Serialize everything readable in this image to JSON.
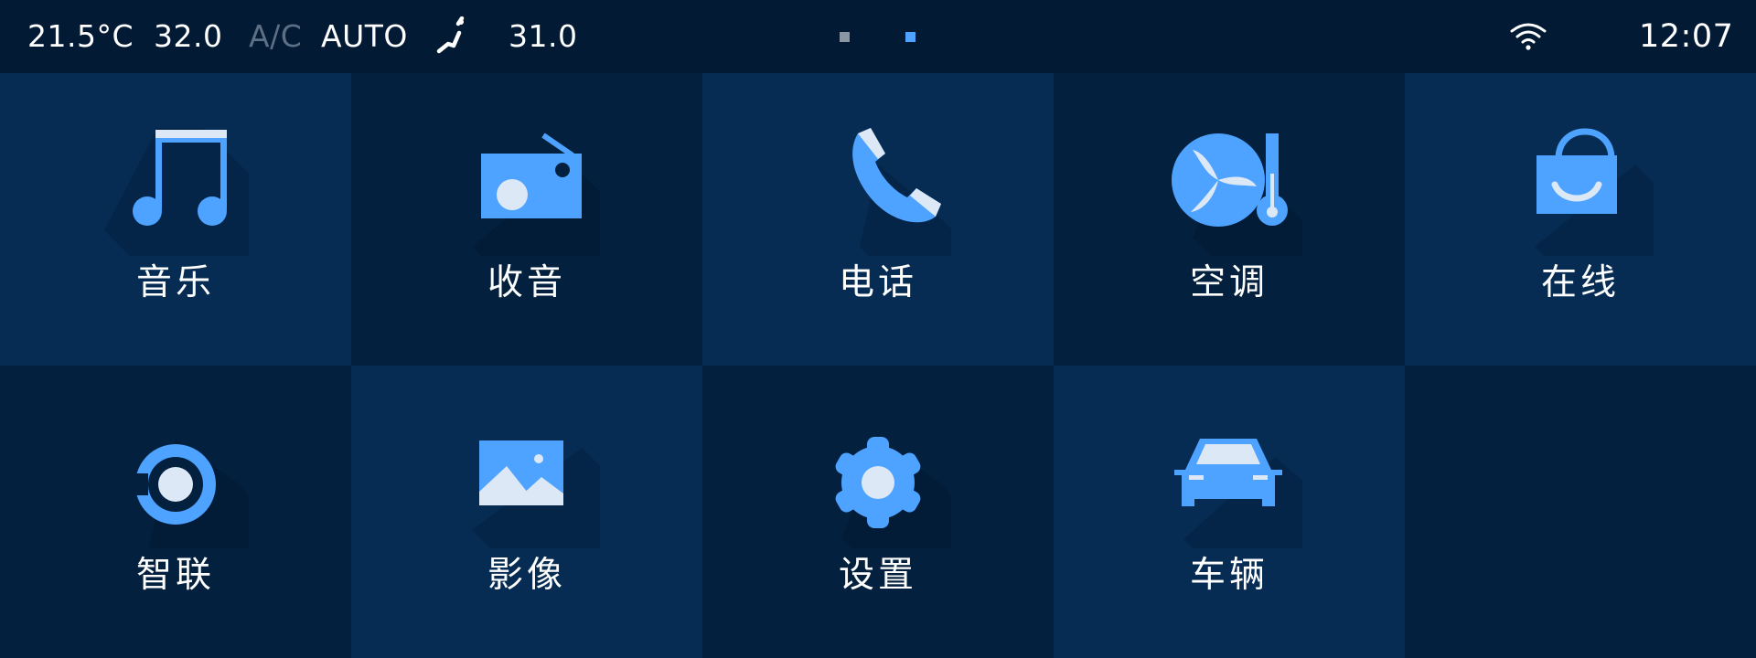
{
  "status_bar": {
    "temperature_left": "21.5°C",
    "setting_left": "32.0",
    "ac_label": "A/C",
    "mode_label": "AUTO",
    "setting_right": "31.0",
    "seat_icon": "seat-airflow-icon",
    "wifi_icon": "wifi-icon",
    "clock": "12:07",
    "pages": {
      "count": 2,
      "active": 2
    }
  },
  "apps": [
    {
      "label": "音乐",
      "icon": "music-note-icon"
    },
    {
      "label": "收音",
      "icon": "radio-icon"
    },
    {
      "label": "电话",
      "icon": "phone-icon"
    },
    {
      "label": "空调",
      "icon": "fan-thermometer-icon"
    },
    {
      "label": "在线",
      "icon": "shopping-bag-icon"
    },
    {
      "label": "智联",
      "icon": "connect-icon"
    },
    {
      "label": "影像",
      "icon": "image-icon"
    },
    {
      "label": "设置",
      "icon": "gear-icon"
    },
    {
      "label": "车辆",
      "icon": "car-icon"
    }
  ],
  "colors": {
    "background": "#021a33",
    "tile_light": "#062c53",
    "tile_dark": "#03213f",
    "icon_blue": "#4da3ff",
    "icon_light": "#dce8f5",
    "text": "#ffffff",
    "text_dim": "#5c6f84"
  }
}
